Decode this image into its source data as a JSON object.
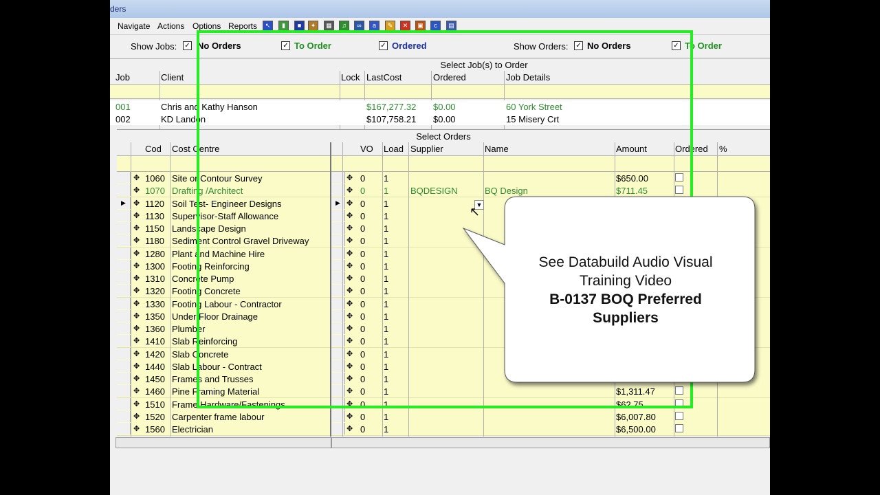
{
  "window": {
    "title": "ders"
  },
  "menu": [
    "Navigate",
    "Actions",
    "Options",
    "Reports"
  ],
  "toolbar_icons": [
    "select-icon",
    "trash-icon",
    "save-icon",
    "tools-icon",
    "grid-icon",
    "music-icon",
    "binoculars-icon",
    "abc-icon",
    "pencil-icon",
    "cancel-icon",
    "box-icon",
    "abc-icon",
    "gallery-icon"
  ],
  "filters": {
    "show_jobs_label": "Show Jobs:",
    "show_orders_label": "Show Orders:",
    "jobs": [
      {
        "label": "No Orders",
        "checked": true,
        "color": "#000000"
      },
      {
        "label": "To Order",
        "checked": true,
        "color": "#1f8f1f"
      },
      {
        "label": "Ordered",
        "checked": true,
        "color": "#1a2fa0"
      }
    ],
    "orders": [
      {
        "label": "No Orders",
        "checked": true,
        "color": "#000000"
      },
      {
        "label": "To Order",
        "checked": true,
        "color": "#1f8f1f"
      }
    ]
  },
  "jobs_panel": {
    "title": "Select Job(s) to Order",
    "headers": {
      "job": "Job",
      "client": "Client",
      "lock": "Lock",
      "lastcost": "LastCost",
      "ordered": "Ordered",
      "details": "Job Details"
    },
    "rows": [
      {
        "job": "001",
        "client": "Chris and Kathy Hanson",
        "lastcost": "$167,277.32",
        "ordered": "$0.00",
        "details": "60 York Street",
        "green": true
      },
      {
        "job": "002",
        "client": "KD Landon",
        "lastcost": "$107,758.21",
        "ordered": "$0.00",
        "details": "15 Misery Crt",
        "green": false
      }
    ]
  },
  "orders_panel": {
    "title": "Select Orders",
    "headers": {
      "code": "Cod",
      "cost_centre": "Cost Centre",
      "vo": "VO",
      "load": "Load",
      "supplier": "Supplier",
      "name": "Name",
      "amount": "Amount",
      "ordered": "Ordered",
      "pct": "%"
    },
    "rows": [
      {
        "code": "1060",
        "cc": "Site or Contour Survey",
        "vo": "0",
        "load": "1",
        "supplier": "",
        "name": "",
        "amount": "$650.00",
        "green": false,
        "checkbox": true
      },
      {
        "code": "1070",
        "cc": "Drafting /Architect",
        "vo": "0",
        "load": "1",
        "supplier": "BQDESIGN",
        "name": "BQ Design",
        "amount": "$711.45",
        "green": true,
        "checkbox": true
      },
      {
        "code": "1120",
        "cc": "Soil Test- Engineer Designs",
        "vo": "0",
        "load": "1",
        "supplier": "",
        "name": "",
        "amount": "",
        "green": false,
        "checkbox": false,
        "current": true
      },
      {
        "code": "1130",
        "cc": "Supervisor-Staff Allowance",
        "vo": "0",
        "load": "1",
        "supplier": "",
        "name": "",
        "amount": "",
        "green": false,
        "checkbox": false
      },
      {
        "code": "1150",
        "cc": "Landscape Design",
        "vo": "0",
        "load": "1",
        "supplier": "",
        "name": "",
        "amount": "",
        "green": false,
        "checkbox": false
      },
      {
        "code": "1180",
        "cc": "Sediment Control Gravel Driveway",
        "vo": "0",
        "load": "1",
        "supplier": "",
        "name": "",
        "amount": "",
        "green": false,
        "checkbox": false
      },
      {
        "code": "1280",
        "cc": "Plant and Machine Hire",
        "vo": "0",
        "load": "1",
        "supplier": "",
        "name": "",
        "amount": "",
        "green": false,
        "checkbox": false
      },
      {
        "code": "1300",
        "cc": "Footing Reinforcing",
        "vo": "0",
        "load": "1",
        "supplier": "",
        "name": "",
        "amount": "",
        "green": false,
        "checkbox": false
      },
      {
        "code": "1310",
        "cc": "Concrete Pump",
        "vo": "0",
        "load": "1",
        "supplier": "",
        "name": "",
        "amount": "",
        "green": false,
        "checkbox": false
      },
      {
        "code": "1320",
        "cc": "Footing Concrete",
        "vo": "0",
        "load": "1",
        "supplier": "",
        "name": "",
        "amount": "",
        "green": false,
        "checkbox": false
      },
      {
        "code": "1330",
        "cc": "Footing Labour - Contractor",
        "vo": "0",
        "load": "1",
        "supplier": "",
        "name": "",
        "amount": "",
        "green": false,
        "checkbox": false
      },
      {
        "code": "1350",
        "cc": "Under Floor Drainage",
        "vo": "0",
        "load": "1",
        "supplier": "",
        "name": "",
        "amount": "",
        "green": false,
        "checkbox": false
      },
      {
        "code": "1360",
        "cc": "Plumber",
        "vo": "0",
        "load": "1",
        "supplier": "",
        "name": "",
        "amount": "",
        "green": false,
        "checkbox": false
      },
      {
        "code": "1410",
        "cc": "Slab Reinforcing",
        "vo": "0",
        "load": "1",
        "supplier": "",
        "name": "",
        "amount": "",
        "green": false,
        "checkbox": false
      },
      {
        "code": "1420",
        "cc": "Slab Concrete",
        "vo": "0",
        "load": "1",
        "supplier": "",
        "name": "",
        "amount": "",
        "green": false,
        "checkbox": false
      },
      {
        "code": "1440",
        "cc": "Slab Labour - Contract",
        "vo": "0",
        "load": "1",
        "supplier": "",
        "name": "",
        "amount": "",
        "green": false,
        "checkbox": false
      },
      {
        "code": "1450",
        "cc": "Frames and Trusses",
        "vo": "0",
        "load": "1",
        "supplier": "",
        "name": "",
        "amount": "",
        "green": false,
        "checkbox": false
      },
      {
        "code": "1460",
        "cc": "Pine Framing Material",
        "vo": "0",
        "load": "1",
        "supplier": "",
        "name": "",
        "amount": "$1,311.47",
        "green": false,
        "checkbox": true
      },
      {
        "code": "1510",
        "cc": "Frame Hardware/Fastenings",
        "vo": "0",
        "load": "1",
        "supplier": "",
        "name": "",
        "amount": "$62.75",
        "green": false,
        "checkbox": true
      },
      {
        "code": "1520",
        "cc": "Carpenter frame labour",
        "vo": "0",
        "load": "1",
        "supplier": "",
        "name": "",
        "amount": "$6,007.80",
        "green": false,
        "checkbox": true
      },
      {
        "code": "1560",
        "cc": "Electrician",
        "vo": "0",
        "load": "1",
        "supplier": "",
        "name": "",
        "amount": "$6,500.00",
        "green": false,
        "checkbox": true
      }
    ]
  },
  "callout": {
    "line1": "See Databuild Audio Visual",
    "line2": "Training Video",
    "line3": "B-0137 BOQ Preferred",
    "line4": "Suppliers"
  },
  "highlight_color": "#22ee22"
}
